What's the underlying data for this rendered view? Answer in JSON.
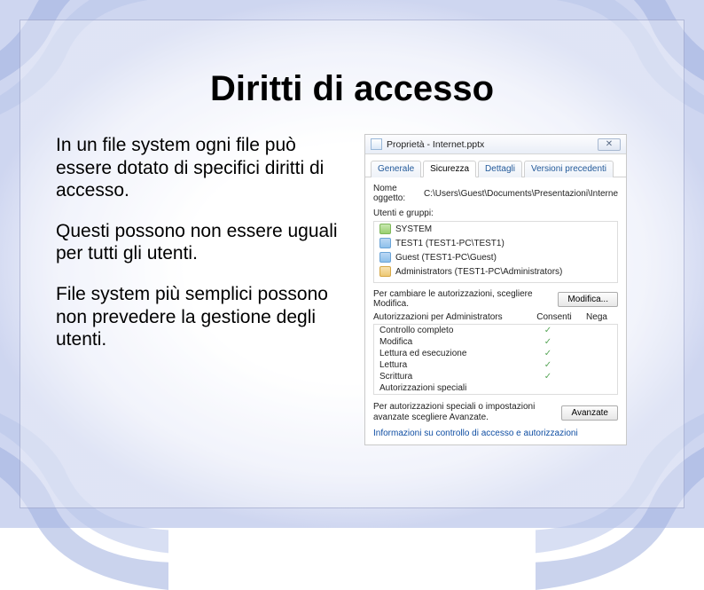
{
  "slide": {
    "title": "Diritti di accesso",
    "paragraphs": [
      "In un file system ogni file può essere dotato di specifici diritti di accesso.",
      "Questi possono non essere uguali per tutti gli utenti.",
      "File system più semplici possono non prevedere la gestione degli utenti."
    ]
  },
  "dialog": {
    "title": "Proprietà - Internet.pptx",
    "tabs": [
      "Generale",
      "Sicurezza",
      "Dettagli",
      "Versioni precedenti"
    ],
    "active_tab": "Sicurezza",
    "object_label": "Nome oggetto:",
    "object_path": "C:\\Users\\Guest\\Documents\\Presentazioni\\Interne",
    "groups_label": "Utenti e gruppi:",
    "groups": [
      {
        "icon": "system",
        "text": "SYSTEM"
      },
      {
        "icon": "user",
        "text": "TEST1 (TEST1-PC\\TEST1)"
      },
      {
        "icon": "user",
        "text": "Guest (TEST1-PC\\Guest)"
      },
      {
        "icon": "admin",
        "text": "Administrators (TEST1-PC\\Administrators)"
      }
    ],
    "modify_text": "Per cambiare le autorizzazioni, scegliere Modifica.",
    "modify_button": "Modifica...",
    "perm_header": "Autorizzazioni per Administrators",
    "perm_cols": {
      "allow": "Consenti",
      "deny": "Nega"
    },
    "perms": [
      {
        "name": "Controllo completo",
        "allow": true,
        "deny": false
      },
      {
        "name": "Modifica",
        "allow": true,
        "deny": false
      },
      {
        "name": "Lettura ed esecuzione",
        "allow": true,
        "deny": false
      },
      {
        "name": "Lettura",
        "allow": true,
        "deny": false
      },
      {
        "name": "Scrittura",
        "allow": true,
        "deny": false
      },
      {
        "name": "Autorizzazioni speciali",
        "allow": false,
        "deny": false
      }
    ],
    "advanced_text": "Per autorizzazioni speciali o impostazioni avanzate scegliere Avanzate.",
    "advanced_button": "Avanzate",
    "link_text": "Informazioni su controllo di accesso e autorizzazioni"
  }
}
